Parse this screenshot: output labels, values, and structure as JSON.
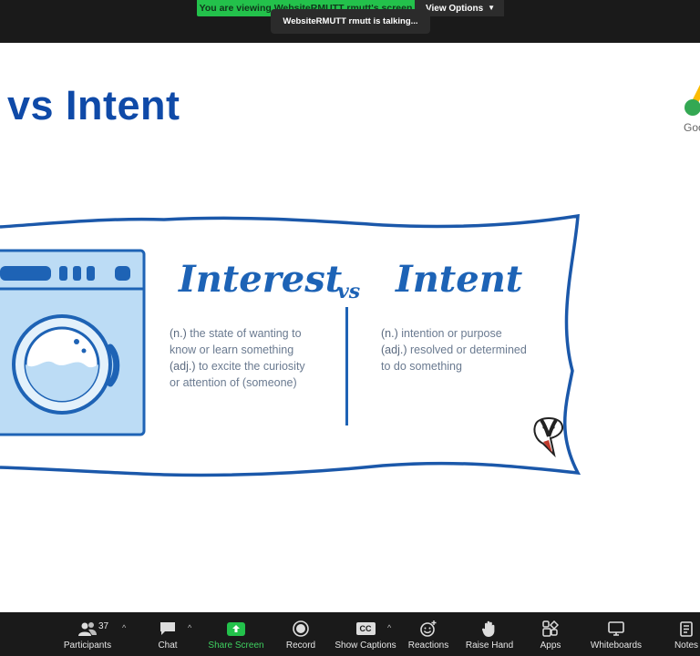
{
  "banner": {
    "viewing_text": "You are viewing WebsiteRMUTT rmutt's screen",
    "view_options_label": "View Options",
    "talking_text": "WebsiteRMUTT rmutt is talking..."
  },
  "slide": {
    "title": "vs Intent",
    "logo_partial_text": "Goo",
    "word_interest": "Interest",
    "word_vs": "vs",
    "word_intent": "Intent",
    "interest_def": {
      "line1_tag": "(n.)",
      "line1_text": " the state of wanting to",
      "line2_text": "know or learn something",
      "line3_tag": "(adj.)",
      "line3_text": " to excite the curiosity",
      "line4_text": "or attention of (someone)"
    },
    "intent_def": {
      "line1_tag": "(n.)",
      "line1_text": " intention or purpose",
      "line2_tag": "(adj.)",
      "line2_text": " resolved or determined",
      "line3_text": "to do something"
    }
  },
  "toolbar": {
    "participants_label": "Participants",
    "participants_count": "37",
    "chat_label": "Chat",
    "share_label": "Share Screen",
    "record_label": "Record",
    "captions_label": "Show Captions",
    "captions_icon_text": "CC",
    "reactions_label": "Reactions",
    "raise_hand_label": "Raise Hand",
    "apps_label": "Apps",
    "whiteboards_label": "Whiteboards",
    "notes_label": "Notes"
  },
  "colors": {
    "share_green": "#23c14b",
    "slide_blue": "#0f4aa8",
    "toolbar_bg": "#1a1a1a"
  }
}
